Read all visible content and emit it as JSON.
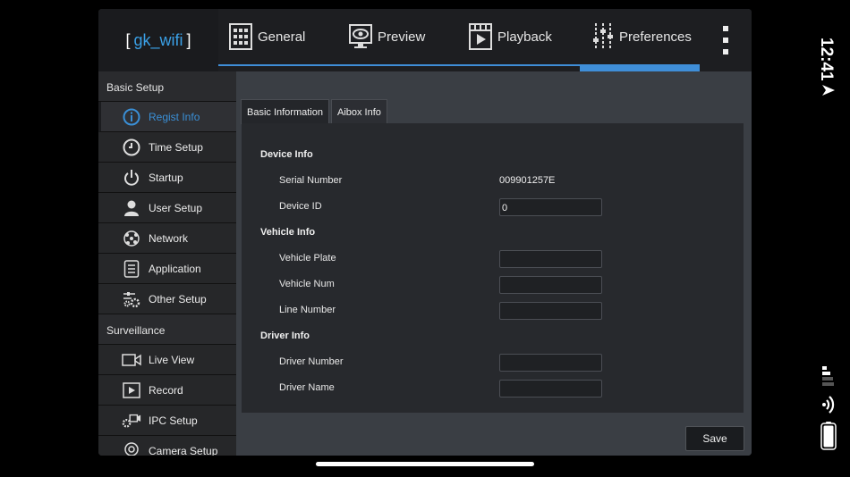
{
  "brand": {
    "open": "[",
    "name": "gk_wifi",
    "close": "]"
  },
  "tabs": [
    {
      "label": "General",
      "icon": "grid-icon"
    },
    {
      "label": "Preview",
      "icon": "monitor-eye-icon"
    },
    {
      "label": "Playback",
      "icon": "film-play-icon"
    },
    {
      "label": "Preferences",
      "icon": "sliders-icon",
      "active": true
    }
  ],
  "sidebar": {
    "basic_header": "Basic Setup",
    "basic_items": [
      {
        "label": "Regist Info",
        "icon": "info-icon",
        "active": true
      },
      {
        "label": "Time Setup",
        "icon": "clock-icon"
      },
      {
        "label": "Startup",
        "icon": "power-icon"
      },
      {
        "label": "User Setup",
        "icon": "user-icon"
      },
      {
        "label": "Network",
        "icon": "network-icon"
      },
      {
        "label": "Application",
        "icon": "document-icon"
      },
      {
        "label": "Other Setup",
        "icon": "gears-icon"
      }
    ],
    "surv_header": "Surveillance",
    "surv_items": [
      {
        "label": "Live View",
        "icon": "camera-icon"
      },
      {
        "label": "Record",
        "icon": "play-box-icon"
      },
      {
        "label": "IPC Setup",
        "icon": "ipc-camera-icon"
      },
      {
        "label": "Camera Setup",
        "icon": "webcam-icon"
      }
    ]
  },
  "subtabs": [
    "Basic Information",
    "Aibox Info"
  ],
  "form": {
    "device_info": "Device Info",
    "serial_label": "Serial Number",
    "serial_value": "009901257E",
    "device_id_label": "Device ID",
    "device_id_value": "0",
    "vehicle_info": "Vehicle Info",
    "vehicle_plate_label": "Vehicle Plate",
    "vehicle_plate_value": "",
    "vehicle_num_label": "Vehicle Num",
    "vehicle_num_value": "",
    "line_number_label": "Line Number",
    "line_number_value": "",
    "driver_info": "Driver Info",
    "driver_number_label": "Driver Number",
    "driver_number_value": "",
    "driver_name_label": "Driver Name",
    "driver_name_value": ""
  },
  "save_label": "Save",
  "status": {
    "time": "12:41"
  },
  "colors": {
    "accent": "#3f8ed8",
    "brand": "#3aa0e6"
  }
}
